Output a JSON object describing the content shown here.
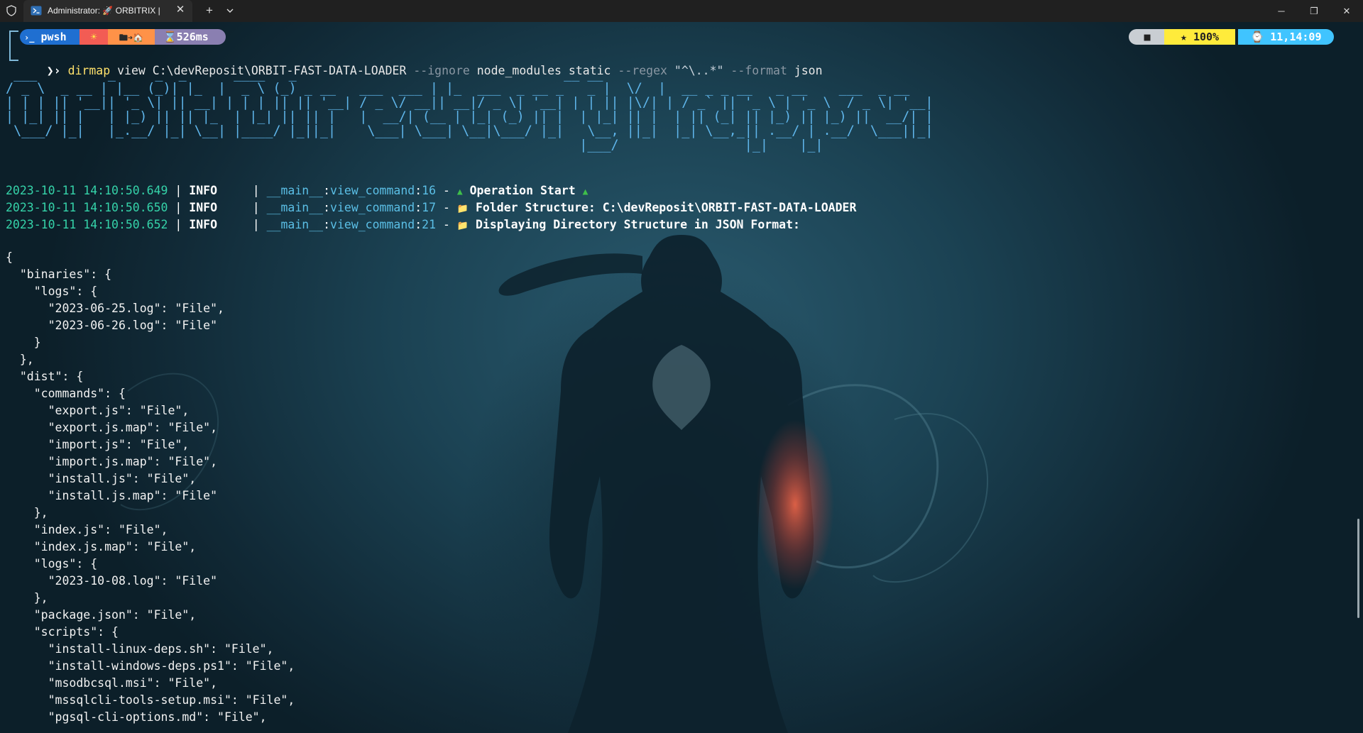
{
  "titlebar": {
    "tab_title": "Administrator: 🚀 ORBITRIX |",
    "new_tab": "+",
    "close_tab": "✕",
    "minimize": "─",
    "restore": "❐",
    "close_window": "✕"
  },
  "prompt": {
    "shell": "pwsh",
    "sun_glyph": "☀",
    "folder_glyph": "🖿➔🏠",
    "duration": "⌛526ms",
    "battery_glyph": "■",
    "battery": "★ 100%",
    "clock": "⌚ 11,14:09",
    "arrow": "❯›",
    "command": "dirmap",
    "args": [
      {
        "t": "view",
        "k": "arg"
      },
      {
        "t": "C:\\devReposit\\ORBIT-FAST-DATA-LOADER",
        "k": "arg"
      },
      {
        "t": "--ignore",
        "k": "flag"
      },
      {
        "t": "node_modules",
        "k": "arg"
      },
      {
        "t": "static",
        "k": "arg"
      },
      {
        "t": "--regex",
        "k": "flag"
      },
      {
        "t": "\"^\\..*\"",
        "k": "str"
      },
      {
        "t": "--format",
        "k": "flag"
      },
      {
        "t": "json",
        "k": "arg"
      }
    ]
  },
  "banner": " ___         _     _  _      ____   _                                  __ __                      \n/ _ \\  _ __ | |__ (_)| |_  |  _ \\ (_) _ __   ___  ___ | |_  ___  _ __ _   _ |  \\/  |  __ _ _ __   _ __    ___  _ __ \n| | | || '__|| '_ \\| || __| | | | || || '__| / _ \\/ __|| __|/ _ \\| '__| | | || |\\/| | / _` || '_ \\ | '_ \\  / _ \\| '__|\n| |_| || |   | |_) || || |_  | |_| || || |   |  __/| (__ | |_| (_) || |  | |_| || |  | || (_| || |_) || |_) ||  __/| |   \n \\___/ |_|   |_.__/ |_| \\__| |____/ |_||_|    \\___| \\___| \\__|\\___/ |_|   \\__, ||_|  |_| \\__,_|| .__/ | .__/  \\___||_|   \n                                                                         |___/                |_|    |_|                ",
  "logs": [
    {
      "ts": "2023-10-11 14:10:50.649",
      "level": "INFO",
      "module": "__main__",
      "func": "view_command",
      "line": "16",
      "icon": "▲",
      "message": "Operation Start",
      "icon2": "▲"
    },
    {
      "ts": "2023-10-11 14:10:50.650",
      "level": "INFO",
      "module": "__main__",
      "func": "view_command",
      "line": "17",
      "icon": "📁",
      "message": "Folder Structure: C:\\devReposit\\ORBIT-FAST-DATA-LOADER",
      "icon2": ""
    },
    {
      "ts": "2023-10-11 14:10:50.652",
      "level": "INFO",
      "module": "__main__",
      "func": "view_command",
      "line": "21",
      "icon": "📁",
      "message": "Displaying Directory Structure in JSON Format:",
      "icon2": ""
    }
  ],
  "json_output": [
    "{",
    "  \"binaries\": {",
    "    \"logs\": {",
    "      \"2023-06-25.log\": \"File\",",
    "      \"2023-06-26.log\": \"File\"",
    "    }",
    "  },",
    "  \"dist\": {",
    "    \"commands\": {",
    "      \"export.js\": \"File\",",
    "      \"export.js.map\": \"File\",",
    "      \"import.js\": \"File\",",
    "      \"import.js.map\": \"File\",",
    "      \"install.js\": \"File\",",
    "      \"install.js.map\": \"File\"",
    "    },",
    "    \"index.js\": \"File\",",
    "    \"index.js.map\": \"File\",",
    "    \"logs\": {",
    "      \"2023-10-08.log\": \"File\"",
    "    },",
    "    \"package.json\": \"File\",",
    "    \"scripts\": {",
    "      \"install-linux-deps.sh\": \"File\",",
    "      \"install-windows-deps.ps1\": \"File\",",
    "      \"msodbcsql.msi\": \"File\",",
    "      \"mssqlcli-tools-setup.msi\": \"File\",",
    "      \"pgsql-cli-options.md\": \"File\","
  ],
  "colors": {
    "pwsh_segment": "#1f6fd1",
    "sun_segment": "#f25c54",
    "folder_segment": "#ff9248",
    "duration_segment": "#8a7fb1",
    "battery_segment": "#ffeb3b",
    "clock_segment": "#40c4ff",
    "timestamp": "#35d3a9",
    "banner": "#5fb5ea"
  }
}
